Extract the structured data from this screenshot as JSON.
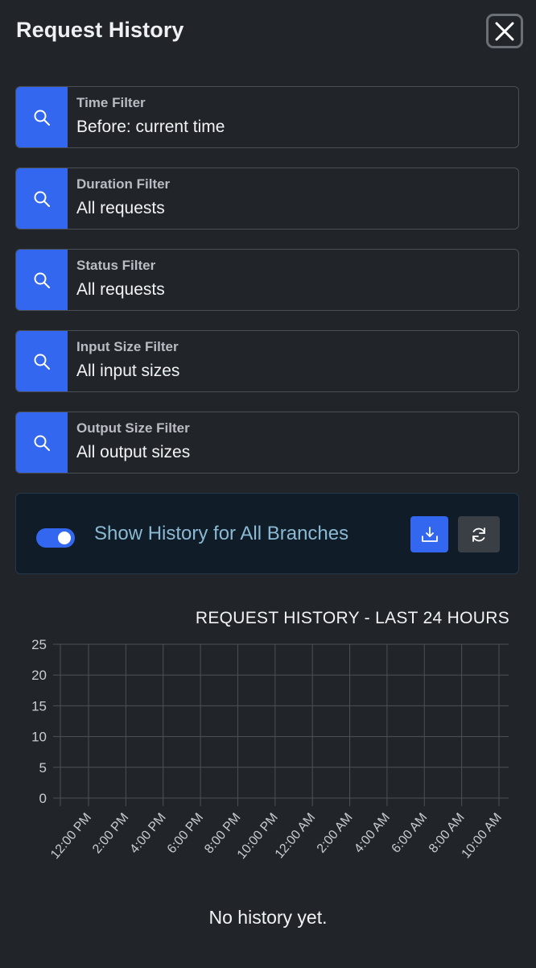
{
  "header": {
    "title": "Request History",
    "close_icon": "close-icon"
  },
  "filters": [
    {
      "label": "Time Filter",
      "value": "Before: current time",
      "icon": "search-icon"
    },
    {
      "label": "Duration Filter",
      "value": "All requests",
      "icon": "search-icon"
    },
    {
      "label": "Status Filter",
      "value": "All requests",
      "icon": "search-icon"
    },
    {
      "label": "Input Size Filter",
      "value": "All input sizes",
      "icon": "search-icon"
    },
    {
      "label": "Output Size Filter",
      "value": "All output sizes",
      "icon": "search-icon"
    }
  ],
  "branches": {
    "label": "Show History for All Branches",
    "toggle_on": true,
    "download_icon": "download-icon",
    "refresh_icon": "refresh-icon"
  },
  "colors": {
    "accent": "#3467f0",
    "background": "#212429",
    "panel": "#101c27",
    "branch_text": "#8ab9d4"
  },
  "chart_data": {
    "type": "line",
    "title": "REQUEST HISTORY - LAST 24 HOURS",
    "xlabel": "",
    "ylabel": "",
    "categories": [
      "12:00 PM",
      "2:00 PM",
      "4:00 PM",
      "6:00 PM",
      "8:00 PM",
      "10:00 PM",
      "12:00 AM",
      "2:00 AM",
      "4:00 AM",
      "6:00 AM",
      "8:00 AM",
      "10:00 AM"
    ],
    "yticks": [
      0,
      5,
      10,
      15,
      20,
      25
    ],
    "ylim": [
      0,
      25
    ],
    "series": [],
    "grid": true
  },
  "empty_message": "No history yet."
}
